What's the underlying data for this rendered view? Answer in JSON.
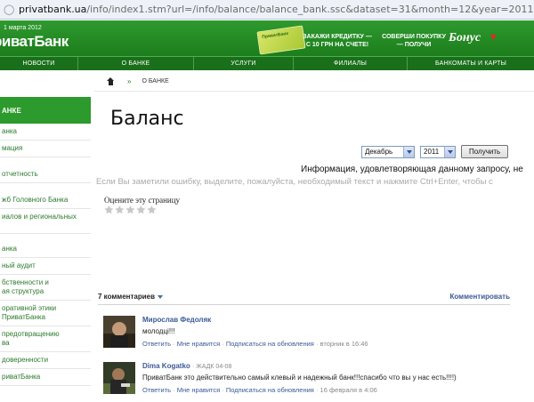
{
  "browser": {
    "url_domain": "privatbank.ua",
    "url_path": "/info/index1.stm?url=/info/balance/balance_bank.ssc&dataset=31&month=12&year=2011"
  },
  "header": {
    "date": "1 марта 2012",
    "logo": "риватБанк",
    "promo_card_label": "ПриватБанк",
    "promo1": "ЗАКАЖИ КРЕДИТКУ — С 10 ГРН НА СЧЕТЕ!",
    "promo2": "СОВЕРШИ ПОКУПКУ — ПОЛУЧИ",
    "bonus": "Бонус"
  },
  "nav": [
    "НОВОСТИ",
    "О БАНКЕ",
    "УСЛУГИ",
    "ФИЛИАЛЫ",
    "БАНКОМАТЫ И КАРТЫ"
  ],
  "sidebar": {
    "heading": "АНКЕ",
    "items": [
      "анка",
      "мация",
      "отчетность",
      "жб Головного Банка",
      "иалов и региональных",
      "анка",
      "ный аудит",
      "бственности и\nая структура",
      "оративной этики\nПриватБанка",
      "предотвращению\nва",
      "доверенности",
      "риватБанка"
    ]
  },
  "breadcrumb": {
    "sep": "»",
    "current": "О БАНКЕ"
  },
  "page_title": "Баланс",
  "filter": {
    "month": "Декабрь",
    "year": "2011",
    "button": "Получить"
  },
  "info_text": "Информация, удовлетворяющая данному запросу, не",
  "hint_text": "Если Вы заметили ошибку, выделите, пожалуйста, необходимый текст и нажмите Ctrl+Enter, чтобы с",
  "rating": {
    "label": "Оцените эту страницу"
  },
  "comments": {
    "count_label": "7 комментариев",
    "comment_link": "Комментировать",
    "list": [
      {
        "author": "Мирослав Федоляк",
        "meta": "",
        "text": "молодці!!!",
        "reply": "Ответить",
        "like": "Мне нравится",
        "subscribe": "Подписаться на обновления",
        "time": "вторник в 16:46"
      },
      {
        "author": "Dima Kogatko",
        "meta": "· ЖАДК 04-08",
        "text": "ПриватБанк это действительно самый клевый и надежный банк!!!спасибо что вы у нас есть!!!!)",
        "reply": "Ответить",
        "like": "Мне нравится",
        "subscribe": "Подписаться на обновления",
        "time": "16 февраля в 4:06"
      }
    ]
  }
}
